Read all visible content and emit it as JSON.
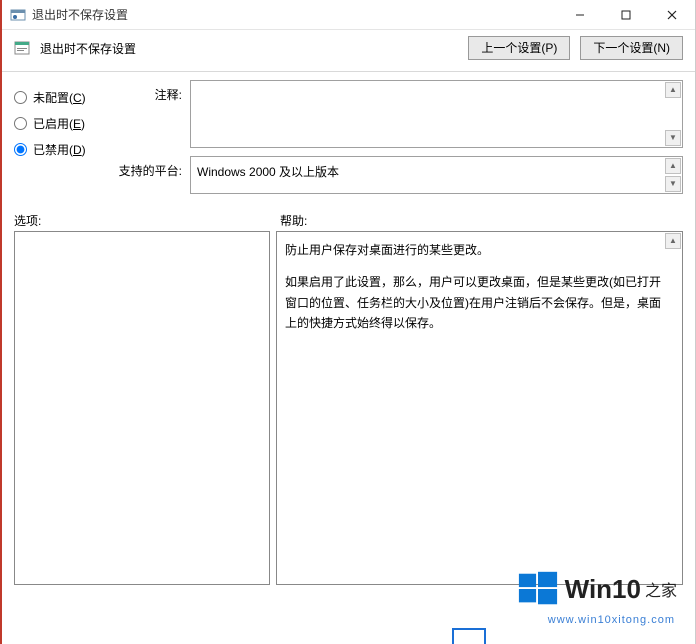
{
  "titlebar": {
    "title": "退出时不保存设置"
  },
  "header": {
    "title": "退出时不保存设置",
    "prev_btn": "上一个设置(P)",
    "next_btn": "下一个设置(N)"
  },
  "config": {
    "not_configured": "未配置(C)",
    "enabled": "已启用(E)",
    "disabled": "已禁用(D)",
    "selected": "disabled"
  },
  "rows": {
    "comment_label": "注释:",
    "comment_value": "",
    "platform_label": "支持的平台:",
    "platform_value": "Windows 2000 及以上版本"
  },
  "panels": {
    "options_label": "选项:",
    "help_label": "帮助:",
    "help_p1": "防止用户保存对桌面进行的某些更改。",
    "help_p2": "如果启用了此设置，那么，用户可以更改桌面，但是某些更改(如已打开窗口的位置、任务栏的大小及位置)在用户注销后不会保存。但是，桌面上的快捷方式始终得以保存。"
  },
  "watermark": {
    "brand": "Win10",
    "suffix": "之家",
    "url": "www.win10xitong.com"
  }
}
